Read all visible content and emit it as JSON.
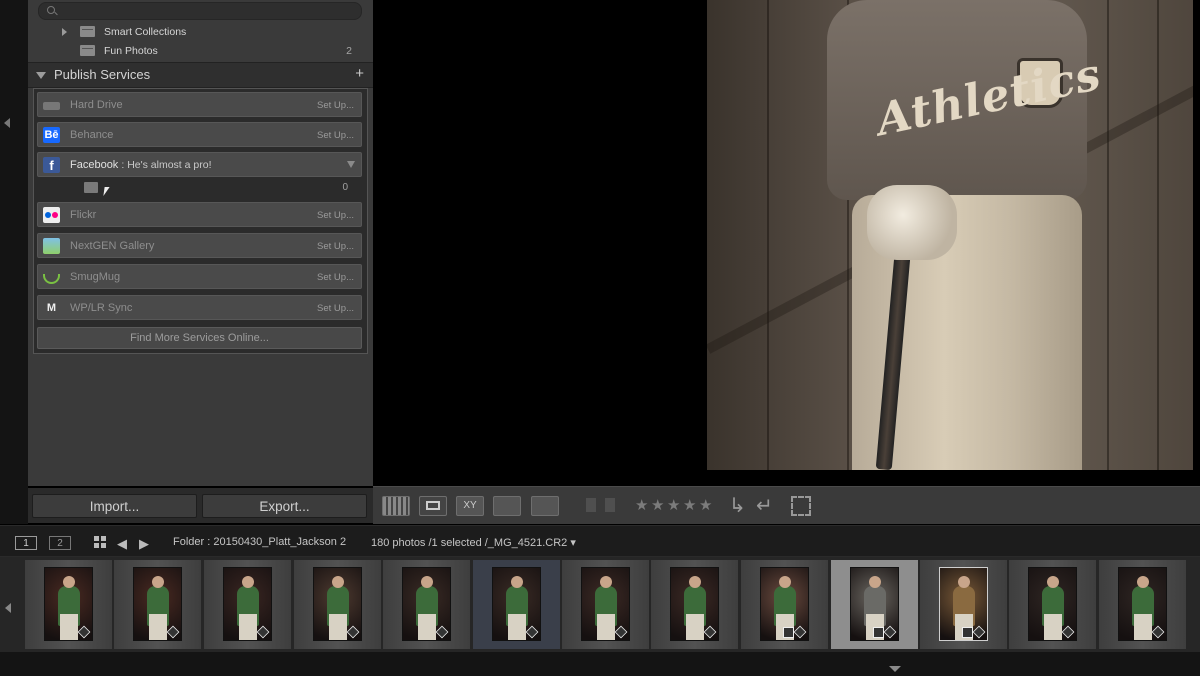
{
  "collections": {
    "search_placeholder": "",
    "items": [
      {
        "label": "Smart Collections",
        "count": ""
      },
      {
        "label": "Fun Photos",
        "count": "2"
      }
    ]
  },
  "publish": {
    "title": "Publish Services",
    "add_symbol": "+",
    "setup_label": "Set Up...",
    "services": [
      {
        "name": "Hard Drive",
        "icon": "hard-drive-icon"
      },
      {
        "name": "Behance",
        "icon": "behance-icon"
      },
      {
        "name": "Facebook",
        "icon": "facebook-icon",
        "subtitle": ": He's almost a pro!",
        "sub_count": "0"
      },
      {
        "name": "Flickr",
        "icon": "flickr-icon"
      },
      {
        "name": "NextGEN Gallery",
        "icon": "nextgen-icon"
      },
      {
        "name": "SmugMug",
        "icon": "smugmug-icon"
      },
      {
        "name": "WP/LR Sync",
        "icon": "wplr-icon"
      }
    ],
    "find_more": "Find More Services Online..."
  },
  "buttons": {
    "import": "Import...",
    "export": "Export..."
  },
  "photo": {
    "jersey_text": "Athletics"
  },
  "toolbar": {
    "icons": [
      "grid-view-icon",
      "loupe-view-icon",
      "compare-view-icon",
      "survey-view-icon",
      "people-view-icon"
    ],
    "compare_label": "XY",
    "stars": [
      "★",
      "★",
      "★",
      "★",
      "★"
    ]
  },
  "filmstrip_header": {
    "monitor1": "1",
    "monitor2": "2",
    "source": "Folder : 20150430_Platt_Jackson 2",
    "info": "180 photos /1 selected /_MG_4521.CR2 ▾"
  },
  "colors": {
    "panel": "#3a3a3a",
    "button": "#4a4a4a",
    "accent_selected": "#8e8e8e",
    "behance": "#1769ff",
    "facebook": "#3b5998"
  }
}
